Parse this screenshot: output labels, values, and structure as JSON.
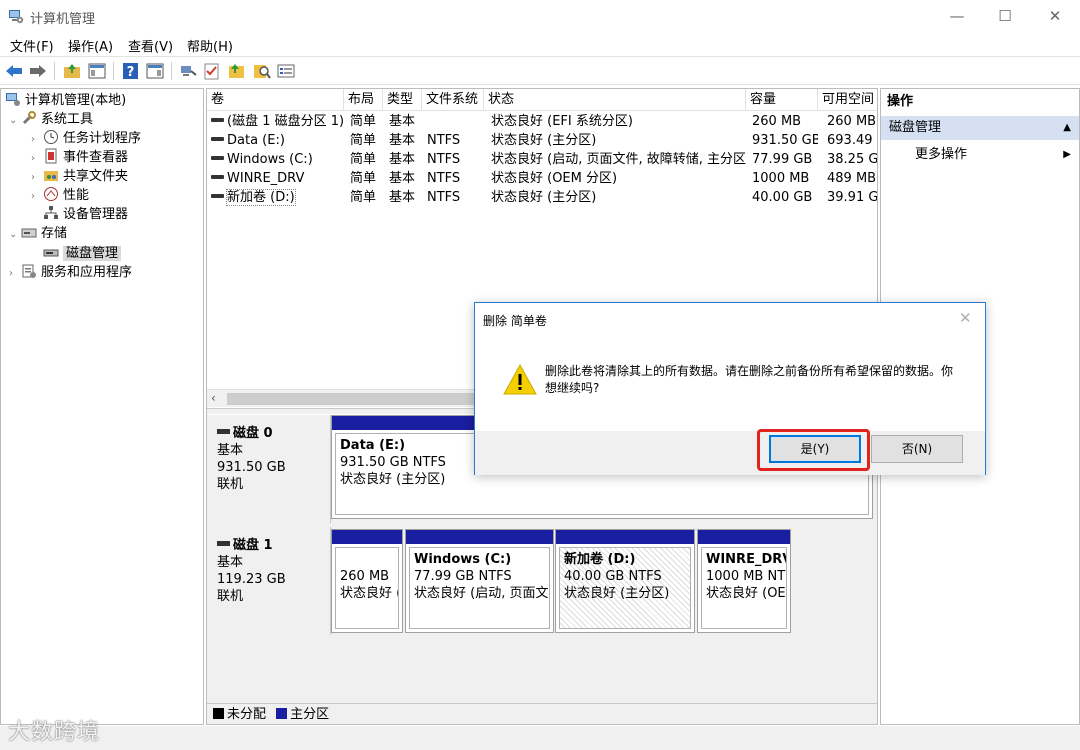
{
  "window": {
    "title": "计算机管理",
    "icon": "computer-management-icon",
    "controls": [
      "—",
      "☐",
      "✕"
    ]
  },
  "menu": [
    "文件(F)",
    "操作(A)",
    "查看(V)",
    "帮助(H)"
  ],
  "toolbar_icons": [
    "back-arrow-icon",
    "forward-arrow-icon",
    "folder-up-icon",
    "show-hide-console-tree-icon",
    "help-icon",
    "show-hide-action-pane-icon",
    "connect-icon",
    "check-icon",
    "folder-icon",
    "search-icon",
    "properties-icon"
  ],
  "tree": {
    "root": "计算机管理(本地)",
    "system_tools": "系统工具",
    "task_scheduler": "任务计划程序",
    "event_viewer": "事件查看器",
    "shared_folders": "共享文件夹",
    "performance": "性能",
    "device_manager": "设备管理器",
    "storage": "存储",
    "disk_management": "磁盘管理",
    "services_apps": "服务和应用程序"
  },
  "volume_table": {
    "headers": [
      "卷",
      "布局",
      "类型",
      "文件系统",
      "状态",
      "容量",
      "可用空间"
    ],
    "rows": [
      {
        "vol": "(磁盘 1 磁盘分区 1)",
        "layout": "简单",
        "type": "基本",
        "fs": "",
        "status": "状态良好 (EFI 系统分区)",
        "capacity": "260 MB",
        "free": "260 MB"
      },
      {
        "vol": "Data (E:)",
        "layout": "简单",
        "type": "基本",
        "fs": "NTFS",
        "status": "状态良好 (主分区)",
        "capacity": "931.50 GB",
        "free": "693.49 G"
      },
      {
        "vol": "Windows (C:)",
        "layout": "简单",
        "type": "基本",
        "fs": "NTFS",
        "status": "状态良好 (启动, 页面文件, 故障转储, 主分区)",
        "capacity": "77.99 GB",
        "free": "38.25 G"
      },
      {
        "vol": "WINRE_DRV",
        "layout": "简单",
        "type": "基本",
        "fs": "NTFS",
        "status": "状态良好 (OEM 分区)",
        "capacity": "1000 MB",
        "free": "489 MB"
      },
      {
        "vol": "新加卷 (D:)",
        "layout": "简单",
        "type": "基本",
        "fs": "NTFS",
        "status": "状态良好 (主分区)",
        "capacity": "40.00 GB",
        "free": "39.91 G"
      }
    ]
  },
  "disks": [
    {
      "name": "磁盘 0",
      "kind": "基本",
      "size": "931.50 GB",
      "state": "联机",
      "partitions": [
        {
          "name": "Data  (E:)",
          "line2": "931.50 GB NTFS",
          "line3": "状态良好 (主分区)"
        }
      ]
    },
    {
      "name": "磁盘 1",
      "kind": "基本",
      "size": "119.23 GB",
      "state": "联机",
      "partitions": [
        {
          "name": "",
          "line2": "260 MB",
          "line3": "状态良好 ("
        },
        {
          "name": "Windows  (C:)",
          "line2": "77.99 GB NTFS",
          "line3": "状态良好 (启动, 页面文("
        },
        {
          "name": "新加卷  (D:)",
          "line2": "40.00 GB NTFS",
          "line3": "状态良好 (主分区)"
        },
        {
          "name": "WINRE_DRV",
          "line2": "1000 MB NT",
          "line3": "状态良好 (OE"
        }
      ]
    }
  ],
  "legend": {
    "unallocated": "未分配",
    "primary": "主分区",
    "unallocated_color": "#000000",
    "primary_color": "#1a1ea0"
  },
  "actions": {
    "header": "操作",
    "section": "磁盘管理",
    "more": "更多操作"
  },
  "dialog": {
    "title": "删除 简单卷",
    "message": "删除此卷将清除其上的所有数据。请在删除之前备份所有希望保留的数据。你想继续吗?",
    "yes": "是(Y)",
    "no": "否(N)",
    "icon": "warning-icon",
    "highlight_color": "#e0231c"
  },
  "watermark": "大数跨境"
}
